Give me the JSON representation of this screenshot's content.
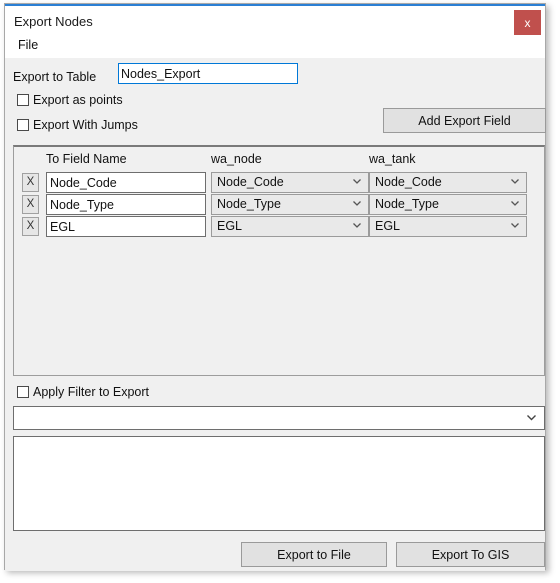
{
  "window": {
    "title": "Export Nodes",
    "close_label": "x",
    "accent_color": "#2a7fd4",
    "close_color": "#c0504d"
  },
  "menu": {
    "items": [
      {
        "label": "File"
      }
    ]
  },
  "form": {
    "export_to_table_label": "Export to Table",
    "export_to_table_value": "Nodes_Export",
    "export_to_table_placeholder": "",
    "checkboxes": [
      {
        "label": "Export as points",
        "checked": false
      },
      {
        "label": "Export With Jumps",
        "checked": false
      }
    ],
    "add_export_field_label": "Add Export Field"
  },
  "fields_panel": {
    "headers": [
      "To Field Name",
      "wa_node",
      "wa_tank"
    ],
    "remove_label": "X",
    "rows": [
      {
        "to_field_name": "Node_Code",
        "wa_node": "Node_Code",
        "wa_tank": "Node_Code"
      },
      {
        "to_field_name": "Node_Type",
        "wa_node": "Node_Type",
        "wa_tank": "Node_Type"
      },
      {
        "to_field_name": "EGL",
        "wa_node": "EGL",
        "wa_tank": "EGL"
      }
    ]
  },
  "filter": {
    "checkbox_label": "Apply Filter to Export",
    "checkbox_checked": false,
    "combo_value": "",
    "textarea_value": ""
  },
  "actions": {
    "export_to_file": "Export to File",
    "export_to_gis": "Export To GIS"
  }
}
